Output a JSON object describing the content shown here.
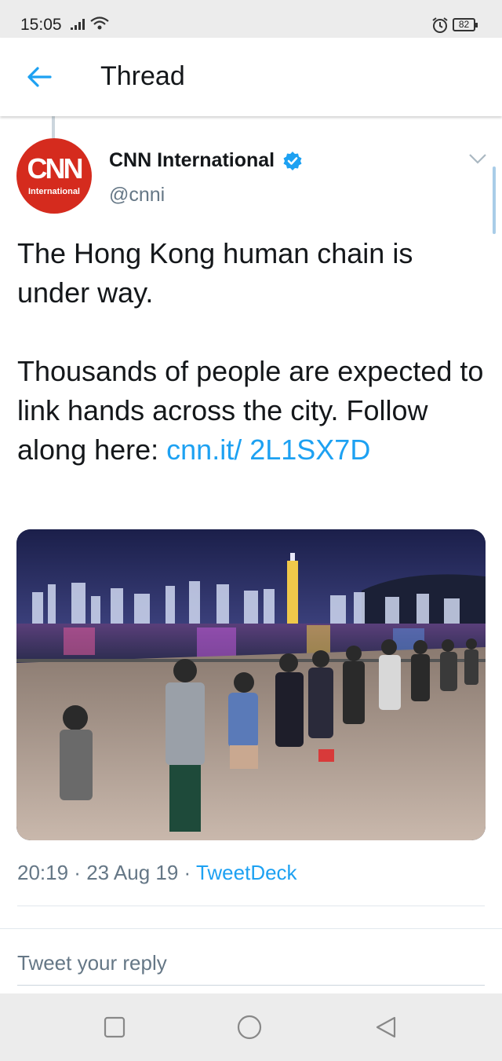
{
  "status_bar": {
    "time": "15:05",
    "battery": "82"
  },
  "header": {
    "title": "Thread"
  },
  "tweet": {
    "author_name": "CNN International",
    "author_handle": "@cnni",
    "avatar_logo": "CNN",
    "avatar_sub": "International",
    "text_line1": "The Hong Kong human chain is under way.",
    "text_line2": "Thousands of people are expected to link hands across the city. Follow along here: ",
    "link": "cnn.it/ 2L1SX7D",
    "time": "20:19",
    "date": "23 Aug 19",
    "source": "TweetDeck",
    "separator": " · "
  },
  "reply": {
    "placeholder": "Tweet your reply"
  },
  "colors": {
    "link": "#1da1f2",
    "avatar": "#d52b1e",
    "verified": "#1da1f2"
  }
}
